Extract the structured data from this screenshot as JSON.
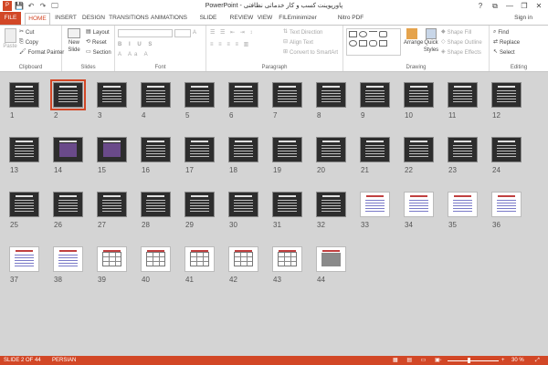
{
  "app": {
    "title": "پاورپوینت کسب و کار خدماتی نظافتی - PowerPoint",
    "signin": "Sign in"
  },
  "qat": {
    "save": "💾",
    "undo": "↶",
    "redo": "↷",
    "start": "🖵"
  },
  "window": {
    "help": "?",
    "ribbon_options": "⧉",
    "minimize": "—",
    "restore": "❐",
    "close": "✕"
  },
  "tabs": [
    "FILE",
    "HOME",
    "INSERT",
    "DESIGN",
    "TRANSITIONS",
    "ANIMATIONS",
    "SLIDE SHOW",
    "REVIEW",
    "VIEW",
    "FILEminimizer",
    "Nitro PDF Professional"
  ],
  "ribbon": {
    "clipboard": {
      "label": "Clipboard",
      "paste": "Paste",
      "cut": "Cut",
      "copy": "Copy",
      "format_painter": "Format Painter"
    },
    "slides": {
      "label": "Slides",
      "new_slide": "New Slide",
      "layout": "Layout",
      "reset": "Reset",
      "section": "Section"
    },
    "font": {
      "label": "Font"
    },
    "paragraph": {
      "label": "Paragraph",
      "text_direction": "Text Direction",
      "align_text": "Align Text",
      "convert": "Convert to SmartArt"
    },
    "drawing": {
      "label": "Drawing",
      "arrange": "Arrange",
      "quick_styles": "Quick Styles",
      "shape_fill": "Shape Fill",
      "shape_outline": "Shape Outline",
      "shape_effects": "Shape Effects"
    },
    "editing": {
      "label": "Editing",
      "find": "Find",
      "replace": "Replace",
      "select": "Select"
    }
  },
  "slides": [
    {
      "n": "1",
      "kind": "dark"
    },
    {
      "n": "2",
      "kind": "dark",
      "selected": true
    },
    {
      "n": "3",
      "kind": "dark"
    },
    {
      "n": "4",
      "kind": "dark"
    },
    {
      "n": "5",
      "kind": "dark"
    },
    {
      "n": "6",
      "kind": "dark"
    },
    {
      "n": "7",
      "kind": "dark"
    },
    {
      "n": "8",
      "kind": "dark"
    },
    {
      "n": "9",
      "kind": "dark"
    },
    {
      "n": "10",
      "kind": "dark"
    },
    {
      "n": "11",
      "kind": "dark"
    },
    {
      "n": "12",
      "kind": "dark"
    },
    {
      "n": "13",
      "kind": "dark"
    },
    {
      "n": "14",
      "kind": "image"
    },
    {
      "n": "15",
      "kind": "image"
    },
    {
      "n": "16",
      "kind": "dark"
    },
    {
      "n": "17",
      "kind": "dark"
    },
    {
      "n": "18",
      "kind": "dark"
    },
    {
      "n": "19",
      "kind": "dark"
    },
    {
      "n": "20",
      "kind": "dark"
    },
    {
      "n": "21",
      "kind": "dark"
    },
    {
      "n": "22",
      "kind": "dark"
    },
    {
      "n": "23",
      "kind": "dark"
    },
    {
      "n": "24",
      "kind": "dark"
    },
    {
      "n": "25",
      "kind": "dark"
    },
    {
      "n": "26",
      "kind": "dark"
    },
    {
      "n": "27",
      "kind": "dark"
    },
    {
      "n": "28",
      "kind": "dark"
    },
    {
      "n": "29",
      "kind": "dark"
    },
    {
      "n": "30",
      "kind": "dark"
    },
    {
      "n": "31",
      "kind": "dark"
    },
    {
      "n": "32",
      "kind": "dark"
    },
    {
      "n": "33",
      "kind": "white"
    },
    {
      "n": "34",
      "kind": "white"
    },
    {
      "n": "35",
      "kind": "white"
    },
    {
      "n": "36",
      "kind": "white"
    },
    {
      "n": "37",
      "kind": "white"
    },
    {
      "n": "38",
      "kind": "white"
    },
    {
      "n": "39",
      "kind": "table"
    },
    {
      "n": "40",
      "kind": "table"
    },
    {
      "n": "41",
      "kind": "table"
    },
    {
      "n": "42",
      "kind": "table"
    },
    {
      "n": "43",
      "kind": "table"
    },
    {
      "n": "44",
      "kind": "photo"
    }
  ],
  "status": {
    "slide": "SLIDE 2 OF 44",
    "language": "PERSIAN",
    "zoom": "30 %"
  },
  "colors": {
    "accent": "#d24726"
  }
}
